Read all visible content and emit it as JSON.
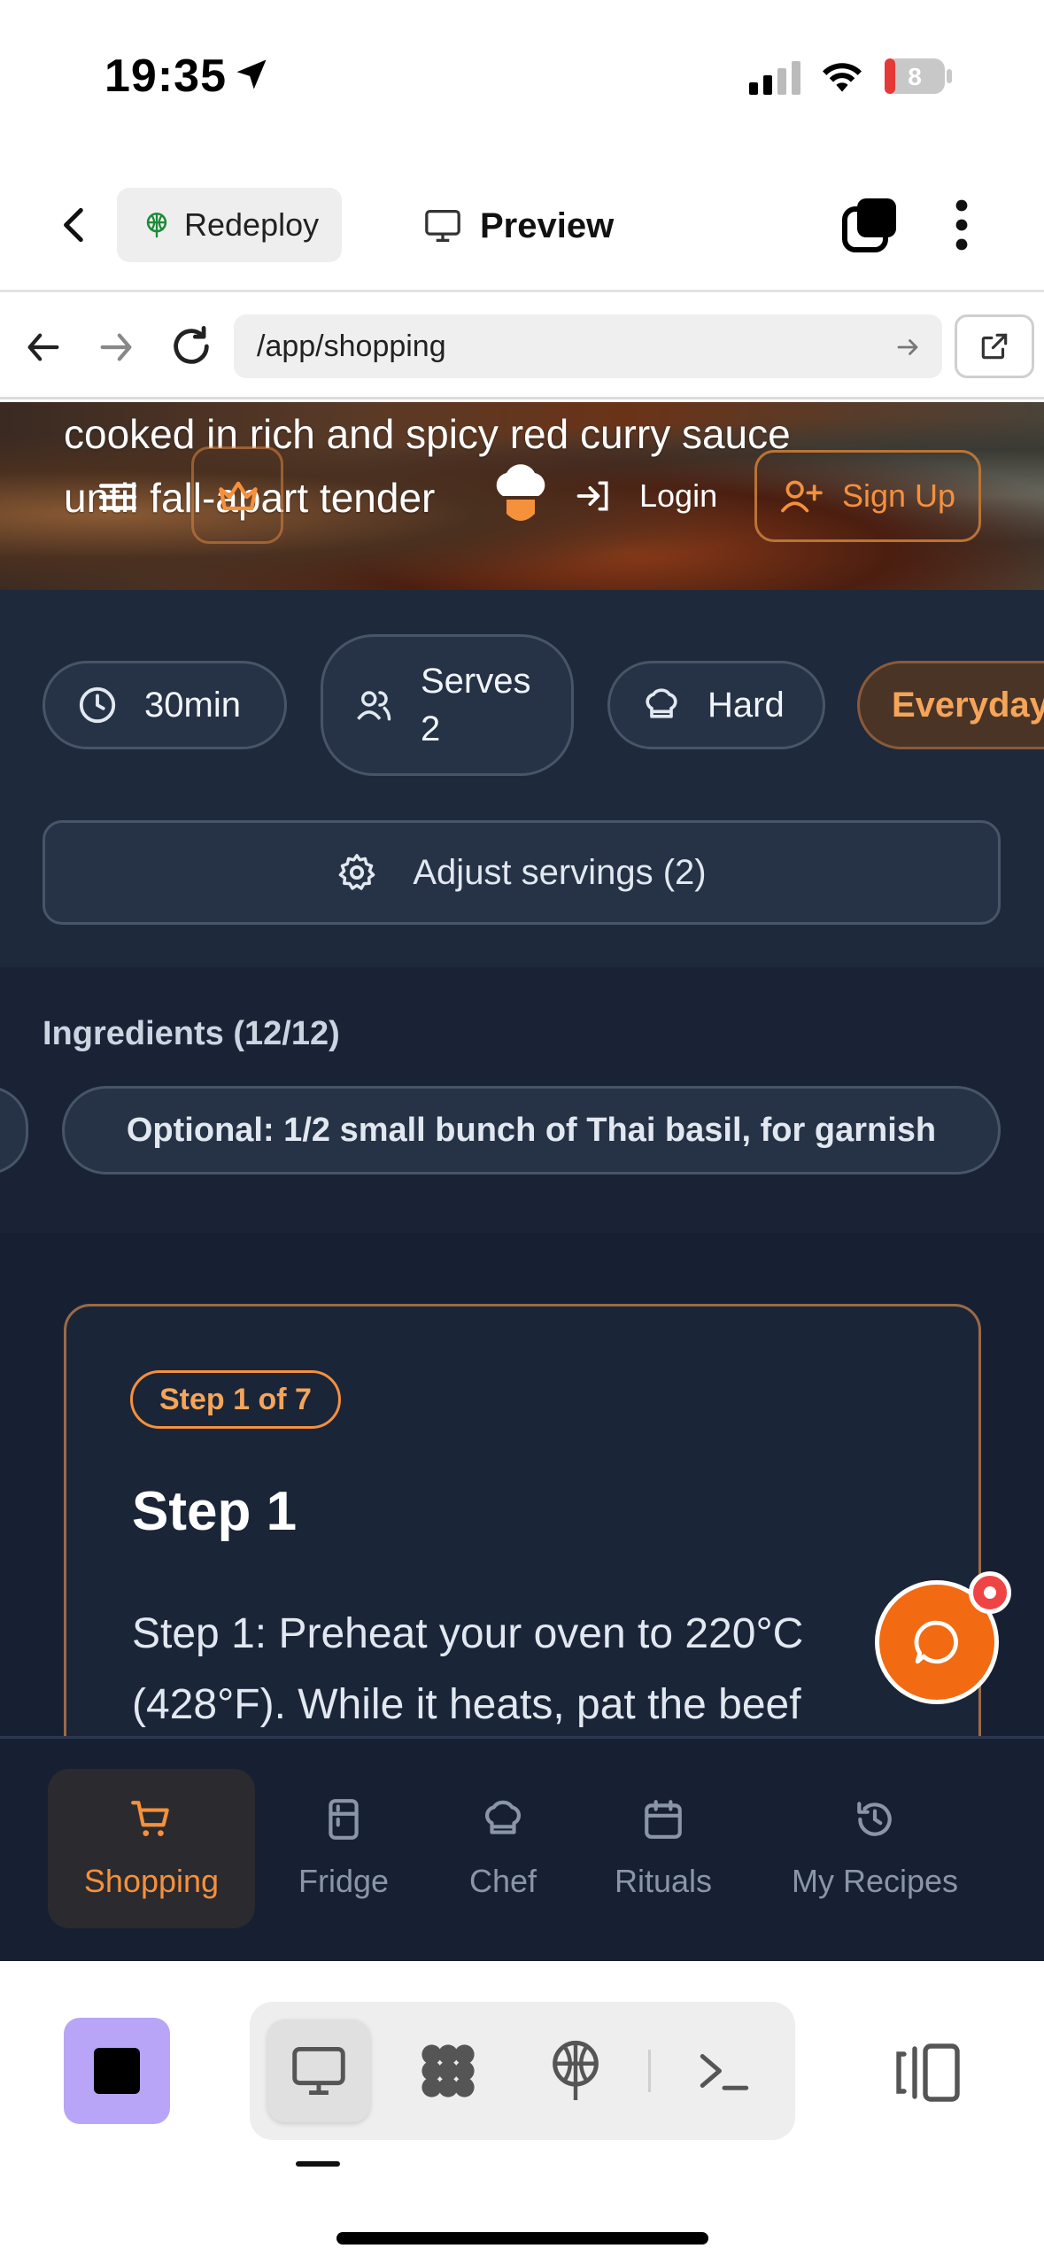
{
  "status_bar": {
    "time": "19:35",
    "battery": "8",
    "icons": [
      "location-arrow-icon",
      "cellular-signal-icon",
      "wifi-icon",
      "battery-icon"
    ]
  },
  "toolbar": {
    "redeploy_label": "Redeploy",
    "preview_label": "Preview"
  },
  "url_bar": {
    "url": "/app/shopping"
  },
  "hero": {
    "description_line1": "cooked in rich and spicy red curry sauce",
    "description_line2": "until fall-apart tender",
    "login_label": "Login",
    "signup_label": "Sign Up"
  },
  "meta": {
    "time": "30min",
    "serves_line1": "Serves",
    "serves_line2": "2",
    "difficulty": "Hard",
    "category": "Everyday",
    "adjust_label": "Adjust servings (2)"
  },
  "ingredients": {
    "title": "Ingredients (12/12)",
    "visible_item": "Optional: 1/2 small bunch of Thai basil, for garnish"
  },
  "step": {
    "badge": "Step 1 of 7",
    "title": "Step 1",
    "text": "Step 1: Preheat your oven to 220°C (428°F). While it heats, pat the beef"
  },
  "bottom_nav": {
    "items": [
      {
        "label": "Shopping",
        "icon": "cart-icon",
        "active": true
      },
      {
        "label": "Fridge",
        "icon": "fridge-icon",
        "active": false
      },
      {
        "label": "Chef",
        "icon": "chef-hat-icon",
        "active": false
      },
      {
        "label": "Rituals",
        "icon": "calendar-icon",
        "active": false
      },
      {
        "label": "My Recipes",
        "icon": "history-icon",
        "active": false
      }
    ]
  },
  "colors": {
    "accent": "#f5903c",
    "app_bg": "#172033",
    "fab": "#f26a12",
    "stop_button": "#b8a5f7"
  }
}
